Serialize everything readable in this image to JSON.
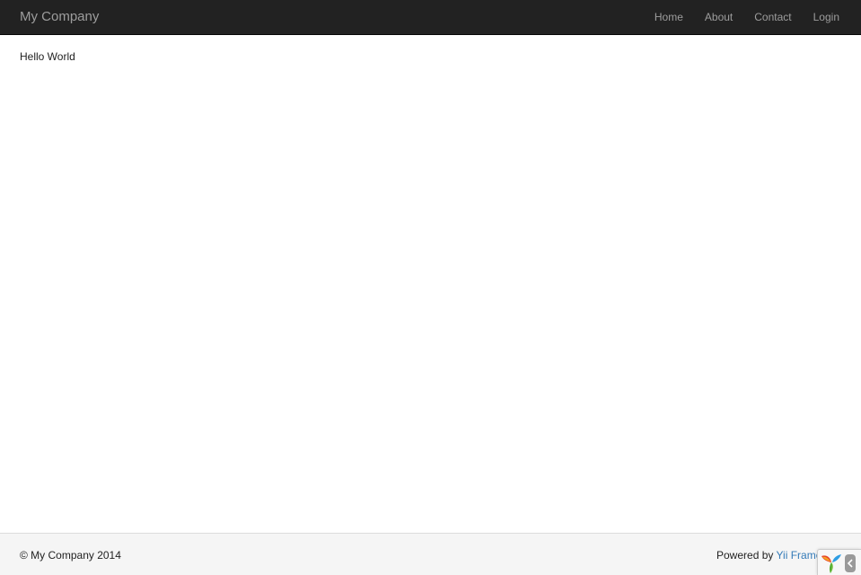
{
  "navbar": {
    "brand": "My Company",
    "items": [
      {
        "label": "Home"
      },
      {
        "label": "About"
      },
      {
        "label": "Contact"
      },
      {
        "label": "Login"
      }
    ]
  },
  "main": {
    "text": "Hello World"
  },
  "footer": {
    "copyright": "© My Company 2014",
    "powered_prefix": "Powered by ",
    "powered_link": "Yii Frame"
  },
  "debug_toolbar": {
    "logo_icon": "yii-logo-icon",
    "toggle_icon": "chevron-left-icon"
  },
  "colors": {
    "navbar_bg": "#222222",
    "nav_text": "#9d9d9d",
    "link": "#337ab7",
    "footer_bg": "#f5f5f5"
  }
}
